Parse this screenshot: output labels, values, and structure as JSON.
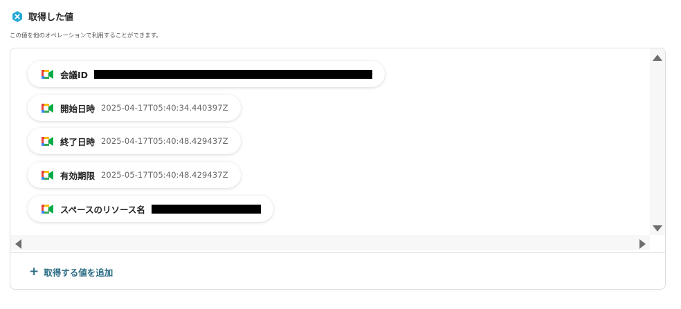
{
  "header": {
    "title": "取得した値",
    "description": "この値を他のオペレーションで利用することができます。"
  },
  "values": [
    {
      "label": "会議ID",
      "value": "",
      "redacted": true
    },
    {
      "label": "開始日時",
      "value": "2025-04-17T05:40:34.440397Z",
      "redacted": false
    },
    {
      "label": "終了日時",
      "value": "2025-04-17T05:40:48.429437Z",
      "redacted": false
    },
    {
      "label": "有効期限",
      "value": "2025-05-17T05:40:48.429437Z",
      "redacted": false
    },
    {
      "label": "スペースのリソース名",
      "value": "",
      "redacted": true
    }
  ],
  "add_button": {
    "label": "取得する値を追加"
  },
  "icons": {
    "header": "hex-x-icon",
    "chip": "google-meet-icon",
    "add": "plus-icon"
  },
  "colors": {
    "accent": "#2a6b84",
    "header_icon": "#25a9d6"
  }
}
